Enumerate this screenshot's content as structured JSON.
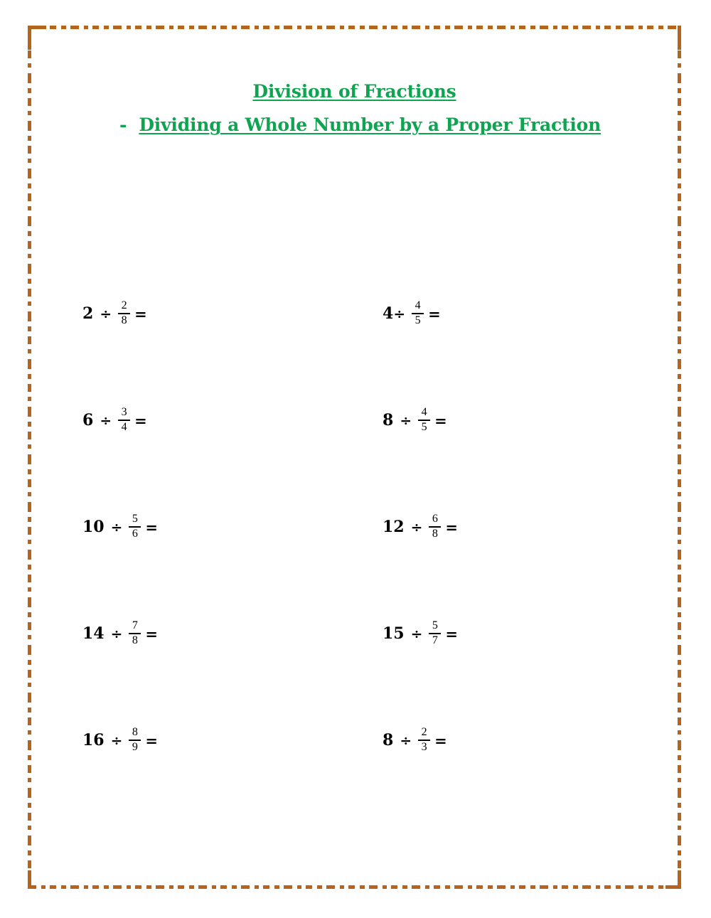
{
  "page": {
    "background_color": "#ffffff",
    "border_color": "#b5641b",
    "heading_color": "#0fa550",
    "text_color": "#000000"
  },
  "heading": {
    "title": "Division of Fractions",
    "bullet": "-",
    "subtitle": "Dividing a Whole Number by a Proper Fraction"
  },
  "symbols": {
    "divide": "÷",
    "equals": "="
  },
  "problems": {
    "rows": [
      {
        "left": {
          "whole": "2",
          "divide": "÷",
          "numerator": "2",
          "denominator": "8",
          "equals": "=",
          "tight": false
        },
        "right": {
          "whole": "4",
          "divide": "÷",
          "numerator": "4",
          "denominator": "5",
          "equals": "=",
          "tight": true
        }
      },
      {
        "left": {
          "whole": "6",
          "divide": "÷",
          "numerator": "3",
          "denominator": "4",
          "equals": "=",
          "tight": false
        },
        "right": {
          "whole": "8",
          "divide": "÷",
          "numerator": "4",
          "denominator": "5",
          "equals": "=",
          "tight": false
        }
      },
      {
        "left": {
          "whole": "10",
          "divide": "÷",
          "numerator": "5",
          "denominator": "6",
          "equals": "=",
          "tight": false
        },
        "right": {
          "whole": "12",
          "divide": "÷",
          "numerator": "6",
          "denominator": "8",
          "equals": "=",
          "tight": false
        }
      },
      {
        "left": {
          "whole": "14",
          "divide": "÷",
          "numerator": "7",
          "denominator": "8",
          "equals": "=",
          "tight": false
        },
        "right": {
          "whole": "15",
          "divide": "÷",
          "numerator": "5",
          "denominator": "7",
          "equals": "=",
          "tight": false
        }
      },
      {
        "left": {
          "whole": "16",
          "divide": "÷",
          "numerator": "8",
          "denominator": "9",
          "equals": "=",
          "tight": false
        },
        "right": {
          "whole": "8",
          "divide": "÷",
          "numerator": "2",
          "denominator": "3",
          "equals": "=",
          "tight": false
        }
      }
    ]
  }
}
